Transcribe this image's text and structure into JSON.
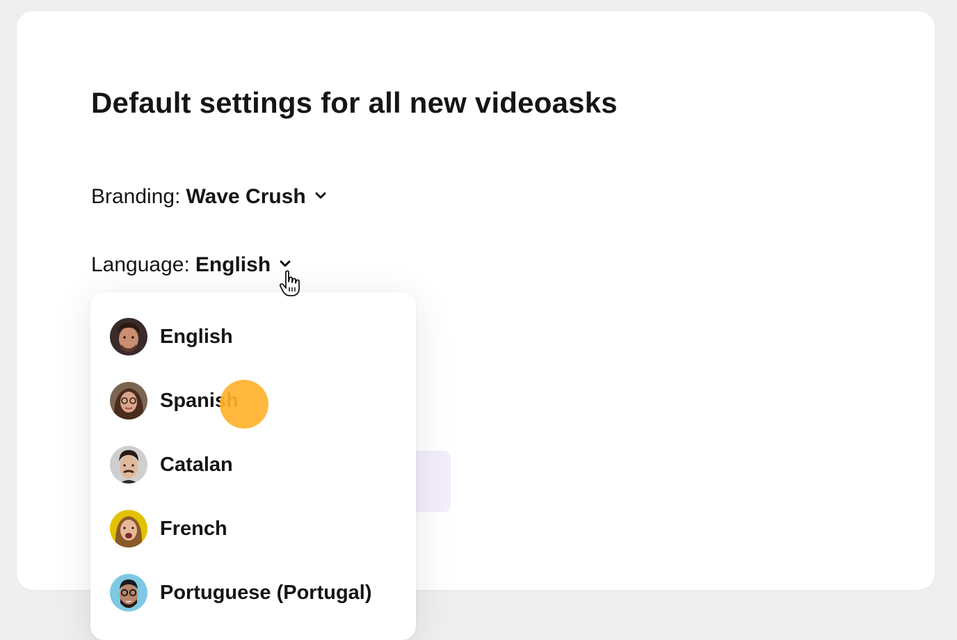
{
  "page": {
    "title": "Default settings for all new videoasks"
  },
  "settings": {
    "branding": {
      "label": "Branding:",
      "value": "Wave Crush"
    },
    "language": {
      "label": "Language:",
      "value": "English"
    }
  },
  "language_dropdown": {
    "options": [
      {
        "label": "English",
        "avatar": "avatar-english"
      },
      {
        "label": "Spanish",
        "avatar": "avatar-spanish"
      },
      {
        "label": "Catalan",
        "avatar": "avatar-catalan"
      },
      {
        "label": "French",
        "avatar": "avatar-french"
      },
      {
        "label": "Portuguese (Portugal)",
        "avatar": "avatar-portuguese"
      }
    ]
  },
  "colors": {
    "accent_click": "#ffb22c",
    "background": "#efefef",
    "card": "#ffffff",
    "text": "#151515"
  },
  "icons": {
    "chevron": "chevron-down-icon",
    "cursor": "hand-pointer-cursor-icon"
  }
}
